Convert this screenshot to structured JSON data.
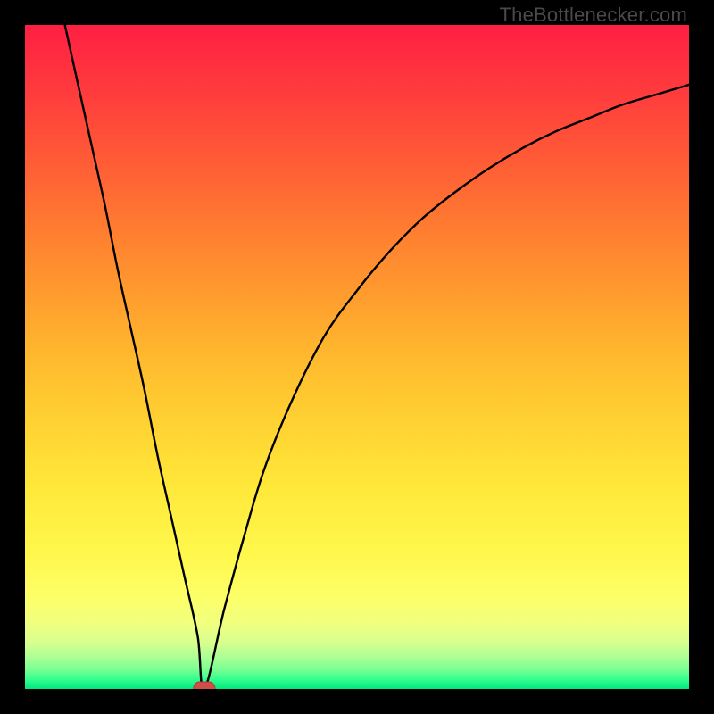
{
  "attribution": "TheBottlenecker.com",
  "colors": {
    "frame": "#000000",
    "curve": "#000000",
    "marker_fill": "#cf4e4a",
    "marker_stroke": "#b23b38"
  },
  "chart_data": {
    "type": "line",
    "title": "",
    "xlabel": "",
    "ylabel": "",
    "xlim": [
      0,
      100
    ],
    "ylim": [
      0,
      100
    ],
    "grid": false,
    "legend": false,
    "axes_visible": false,
    "series": [
      {
        "name": "bottleneck-curve",
        "x": [
          6,
          8,
          10,
          12,
          14,
          16,
          18,
          20,
          22,
          24,
          26,
          27,
          30,
          33,
          36,
          40,
          45,
          50,
          55,
          60,
          65,
          70,
          75,
          80,
          85,
          90,
          95,
          100
        ],
        "y": [
          100,
          91,
          82,
          73,
          63,
          54,
          45,
          35,
          26,
          17,
          8,
          0,
          12,
          23,
          33,
          43,
          53,
          60,
          66,
          71,
          75,
          78.5,
          81.5,
          84,
          86,
          88,
          89.5,
          91
        ]
      }
    ],
    "marker": {
      "name": "optimal-point",
      "x": 27,
      "y": 0,
      "shape": "pill"
    }
  }
}
